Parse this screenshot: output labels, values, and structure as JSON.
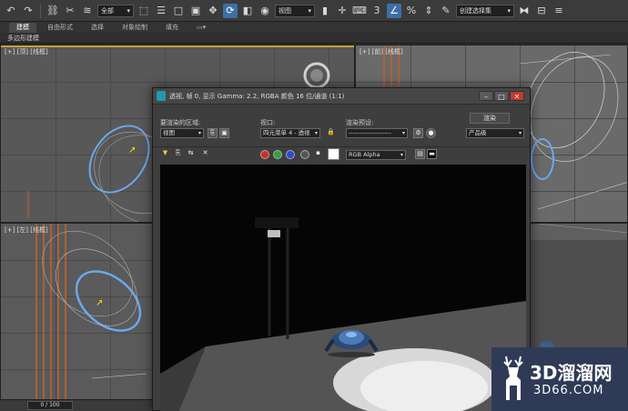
{
  "toolbar": {
    "selection_filter": "全部",
    "reference_coord": "视图",
    "named_selection_placeholder": "创建选择集"
  },
  "ribbon": {
    "tabs": [
      "建模",
      "自由形式",
      "选择",
      "对象绘制",
      "填充"
    ],
    "active_tab": "建模",
    "sub_label": "多边形建模"
  },
  "viewports": {
    "top_label": "[+] [顶] [线框]",
    "front_label": "[+] [前] [线框]",
    "left_label": "[+] [左] [线框]"
  },
  "timeline": {
    "frame_counter": "0 / 100"
  },
  "render_window": {
    "title": "透视, 帧 0, 显示 Gamma: 2.2, RGBA 颜色 16 位/通道 (1:1)",
    "area_label": "要渲染的区域:",
    "area_value": "视图",
    "viewport_label": "视口:",
    "viewport_value": "四元菜单 4 - 透视",
    "preset_label": "渲染预设:",
    "preset_value": "--------------------",
    "render_button": "渲染",
    "production_value": "产品级",
    "channel_value": "RGB Alpha"
  },
  "colors": {
    "accent": "#3c6fa8",
    "wireframe_ring": "#6aa8f0",
    "background": "#2d2d2d"
  },
  "watermark": {
    "text": "3D溜溜网",
    "sub": "3D66.COM"
  }
}
